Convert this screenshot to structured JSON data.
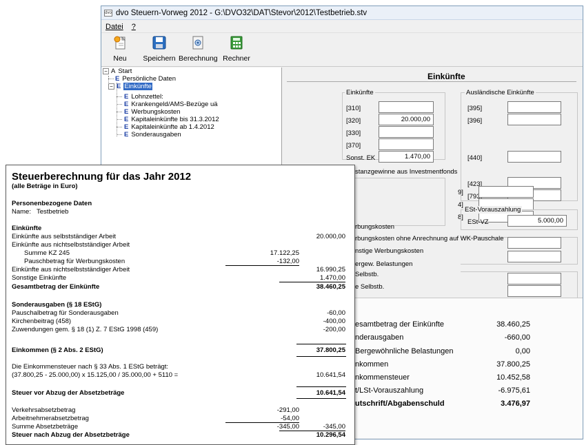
{
  "window": {
    "title": "dvo Steuern-Vorweg 2012 - G:\\DVO32\\DAT\\Stevor\\2012\\Testbetrieb.stv",
    "icon_label": "dvo"
  },
  "menu": {
    "file": "Datei",
    "help": "?"
  },
  "toolbar": {
    "new_label": "Neu",
    "save_label": "Speichern",
    "calc_label": "Berechnung",
    "calculator_label": "Rechner"
  },
  "tree": {
    "root": "Start",
    "items": [
      {
        "prefix": "E",
        "label": "Persönliche Daten"
      },
      {
        "prefix": "E",
        "label": "Einkünfte"
      },
      {
        "prefix": "E",
        "label": "Lohnzettel:"
      },
      {
        "prefix": "E",
        "label": "Krankengeld/AMS-Bezüge uä"
      },
      {
        "prefix": "E",
        "label": "Werbungskosten"
      },
      {
        "prefix": "E",
        "label": "Kapitaleinkünfte bis 31.3.2012"
      },
      {
        "prefix": "E",
        "label": "Kapitaleinkünfte ab 1.4.2012"
      },
      {
        "prefix": "E",
        "label": "Sonderausgaben"
      }
    ]
  },
  "form": {
    "heading": "Einkünfte",
    "group_income": "Einkünfte",
    "income_fields": [
      {
        "label": "[310]",
        "value": ""
      },
      {
        "label": "[320]",
        "value": "20.000,00"
      },
      {
        "label": "[330]",
        "value": ""
      },
      {
        "label": "[370]",
        "value": ""
      },
      {
        "label": "Sonst. EK",
        "value": "1.470,00"
      }
    ],
    "group_foreign": "Ausländische Einkünfte",
    "foreign_fields": [
      {
        "label": "[395]",
        "value": ""
      },
      {
        "label": "[396]",
        "value": ""
      },
      {
        "label": "[440]",
        "value": ""
      },
      {
        "label": "[423]",
        "value": ""
      },
      {
        "label": "[793]",
        "value": ""
      }
    ],
    "group_funds": "stanzgewinne aus Investmentfonds",
    "fund_fields": [
      {
        "label": "9]",
        "value": ""
      },
      {
        "label": "4]",
        "value": ""
      },
      {
        "label": "8]",
        "value": ""
      }
    ],
    "group_prepay": "ESt-Vorauszahlung",
    "prepay_label": "ESt-VZ",
    "prepay_value": "5.000,00",
    "group_wk": "rbungskosten",
    "wk_row1": "rbungskosten ohne Anrechnung auf WK-Pauschale",
    "wk_row2": "nstige Werbungskosten",
    "group_belast": "ergew. Belastungen",
    "belast_row1": "Selbstb.",
    "belast_row2": "e Selbstb.",
    "summary": [
      {
        "label": "esamtbetrag der Einkünfte",
        "value": "38.460,25",
        "bold": false
      },
      {
        "label": "nderausgaben",
        "value": "-660,00",
        "bold": false
      },
      {
        "label": "Bergewöhnliche Belastungen",
        "value": "0,00",
        "bold": false
      },
      {
        "label": "nkommen",
        "value": "37.800,25",
        "bold": false
      },
      {
        "label": "nkommensteuer",
        "value": "10.452,58",
        "bold": false
      },
      {
        "label": "t/LSt-Vorauszahlung",
        "value": "-6.975,61",
        "bold": false
      },
      {
        "label": "utschrift/Abgabenschuld",
        "value": "3.476,97",
        "bold": true
      }
    ]
  },
  "doc": {
    "title": "Steuerberechnung für das Jahr 2012",
    "subtitle": "(alle Beträge in Euro)",
    "sec_personal": "Personenbezogene Daten",
    "name_label": "Name:",
    "name_value": "Testbetrieb",
    "sec_income": "Einkünfte",
    "self_employed": "Einkünfte aus selbstständiger Arbeit",
    "self_employed_value": "20.000,00",
    "employed": "Einkünfte aus nichtselbstständiger Arbeit",
    "kz245": "Summe KZ 245",
    "kz245_value": "17.122,25",
    "wk_flat": "Pauschbetrag für Werbungskosten",
    "wk_flat_value": "-132,00",
    "employed_total": "Einkünfte aus nichtselbstständiger Arbeit",
    "employed_total_value": "16.990,25",
    "other_income": "Sonstige Einkünfte",
    "other_income_value": "1.470,00",
    "total_income": "Gesamtbetrag der Einkünfte",
    "total_income_value": "38.460,25",
    "sec_special": "Sonderausgaben (§ 18 EStG)",
    "special_flat": "Pauschalbetrag für Sonderausgaben",
    "special_flat_value": "-60,00",
    "church": "Kirchenbeitrag (458)",
    "church_value": "-400,00",
    "donations": "Zuwendungen gem. § 18 (1) Z. 7 EStG 1998 (459)",
    "donations_value": "-200,00",
    "sec_taxable": "Einkommen (§ 2 Abs. 2 EStG)",
    "taxable_value": "37.800,25",
    "formula_text": "Die Einkommensteuer nach § 33 Abs. 1 EStG beträgt:",
    "formula": "(37.800,25 - 25.000,00) x 15.125,00 / 35.000,00 + 5110 =",
    "formula_value": "10.641,54",
    "tax_before": "Steuer vor Abzug der Absetzbeträge",
    "tax_before_value": "10.641,54",
    "traffic": "Verkehrsabsetzbetrag",
    "traffic_value": "-291,00",
    "employee": "Arbeitnehmerabsetzbetrag",
    "employee_value": "-54,00",
    "deductions_sum": "Summe Absetzbeträge",
    "deductions_sum_value": "-345,00",
    "deductions_sum_value2": "-345,00",
    "tax_after": "Steuer nach Abzug der Absetzbeträge",
    "tax_after_value": "10.296,54"
  }
}
